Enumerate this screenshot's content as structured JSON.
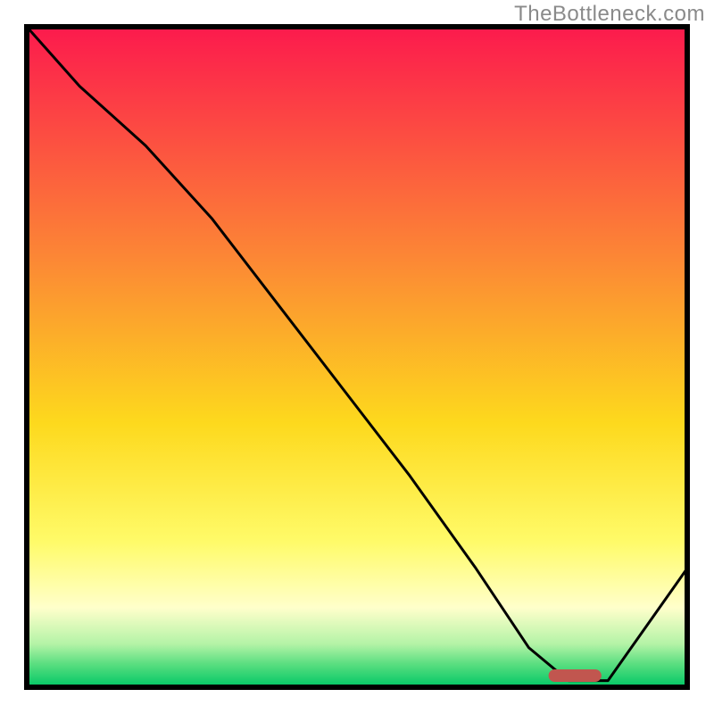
{
  "watermark": "TheBottleneck.com",
  "chart_data": {
    "type": "line",
    "title": "",
    "xlabel": "",
    "ylabel": "",
    "xlim": [
      0,
      100
    ],
    "ylim": [
      0,
      100
    ],
    "x": [
      0,
      8,
      18,
      28,
      38,
      48,
      58,
      68,
      76,
      82,
      88,
      100
    ],
    "values": [
      100,
      91,
      82,
      71,
      58,
      45,
      32,
      18,
      6,
      1,
      1,
      18
    ],
    "annotations": [
      {
        "type": "marker",
        "x_start": 79,
        "x_end": 87,
        "color": "#c1564f"
      }
    ],
    "background": {
      "type": "vertical_gradient",
      "stops": [
        {
          "pos": 0.0,
          "color": "#fc1a4d"
        },
        {
          "pos": 0.35,
          "color": "#fc8735"
        },
        {
          "pos": 0.6,
          "color": "#fdd91d"
        },
        {
          "pos": 0.78,
          "color": "#fffb69"
        },
        {
          "pos": 0.88,
          "color": "#ffffcb"
        },
        {
          "pos": 0.935,
          "color": "#b3f3a6"
        },
        {
          "pos": 0.965,
          "color": "#5ade80"
        },
        {
          "pos": 1.0,
          "color": "#00c765"
        }
      ]
    },
    "border_color": "#000000",
    "curve_color": "#000000",
    "curve_width": 3
  }
}
